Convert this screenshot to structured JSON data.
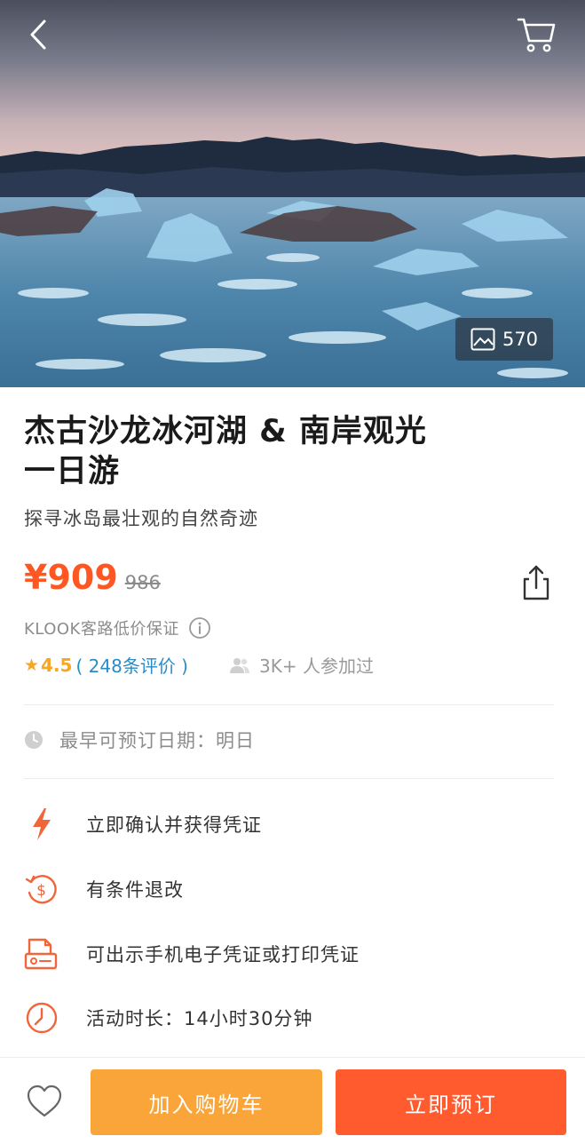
{
  "header": {
    "back_icon": "chevron-left-icon",
    "cart_icon": "cart-icon",
    "photo_count": "570",
    "photo_icon": "image-icon"
  },
  "product": {
    "title_line1": "杰古沙龙冰河湖 & 南岸观光",
    "title_line2": "一日游",
    "subtitle": "探寻冰岛最壮观的自然奇迹",
    "price": "¥909",
    "original_price": "986",
    "guarantee": "KLOOK客路低价保证",
    "rating_star": "★",
    "rating_score": "4.5",
    "reviews": "( 248条评价 )",
    "participants": "3K+ 人参加过",
    "earliest_booking": "最早可预订日期：明日"
  },
  "features": [
    {
      "icon": "lightning-icon",
      "label": "立即确认并获得凭证"
    },
    {
      "icon": "refund-dollar-icon",
      "label": "有条件退改"
    },
    {
      "icon": "voucher-icon",
      "label": "可出示手机电子凭证或打印凭证"
    },
    {
      "icon": "clock-duration-icon",
      "label": "活动时长：14小时30分钟"
    }
  ],
  "actions": {
    "add_to_cart": "加入购物车",
    "book_now": "立即预订",
    "favorite_icon": "heart-icon"
  },
  "colors": {
    "price": "#ff5722",
    "rating": "#f5a623",
    "reviews_link": "#2a8cc7",
    "cart_button": "#f9a53a",
    "book_button": "#ff5b2e",
    "feature_icon": "#f0653a"
  }
}
